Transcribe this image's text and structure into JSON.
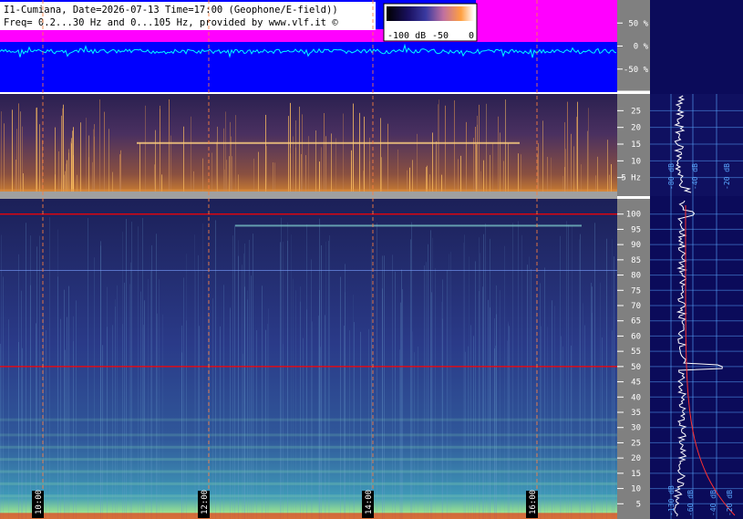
{
  "header": {
    "line1": "I1-Cumiana, Date=2026-07-13 Time=17:00 (Geophone/E-field))",
    "line2": "Freq= 0.2...30 Hz and 0...105 Hz, provided by www.vlf.it ©"
  },
  "colorbar": {
    "labels": [
      "-100 dB",
      "-50",
      "0"
    ]
  },
  "colors": {
    "waveform_bg": "#0000ff",
    "waveform_trace": "#00ffff",
    "envelope": "#ff00ff",
    "spectrogram_low": "#1a1f6e",
    "spectrogram_mid": "#3a6bb0",
    "spectrogram_high": "#ffb040",
    "scale_panel_bg": "#0b0b5a",
    "gridline": "#5aa8ff",
    "marker_line": "#ff0000",
    "hour_line": "#ff8040"
  },
  "chart_data": [
    {
      "type": "line",
      "panel": "amplitude",
      "y_tick_labels": [
        "50 %",
        "0 %",
        "-50 %"
      ],
      "y_ticks": [
        50,
        0,
        -50
      ],
      "ylim": [
        -100,
        100
      ]
    },
    {
      "type": "heatmap",
      "panel": "spectrogram-0.2-30Hz",
      "y_tick_labels": [
        "25",
        "20",
        "15",
        "10",
        "5 Hz"
      ],
      "y_ticks": [
        25,
        20,
        15,
        10,
        5
      ],
      "ylim": [
        0,
        30
      ],
      "spectrum_axis_labels": [
        "-80 dB",
        "-40 dB",
        "-20 dB"
      ]
    },
    {
      "type": "heatmap",
      "panel": "spectrogram-0-105Hz",
      "y_tick_labels": [
        "100",
        "95",
        "90",
        "85",
        "80",
        "75",
        "70",
        "65",
        "60",
        "55",
        "50",
        "45",
        "40",
        "35",
        "30",
        "25",
        "20",
        "15",
        "10",
        "5"
      ],
      "y_ticks": [
        100,
        95,
        90,
        85,
        80,
        75,
        70,
        65,
        60,
        55,
        50,
        45,
        40,
        35,
        30,
        25,
        20,
        15,
        10,
        5
      ],
      "ylim": [
        0,
        105
      ],
      "spectrum_axis_labels": [
        "-130 dB",
        "-60 dB",
        "-40 dB",
        "-20 dB"
      ],
      "time_tick_labels": [
        "10:00",
        "12:00",
        "14:00",
        "16:00"
      ],
      "marker_freqs": [
        100,
        50
      ]
    }
  ]
}
